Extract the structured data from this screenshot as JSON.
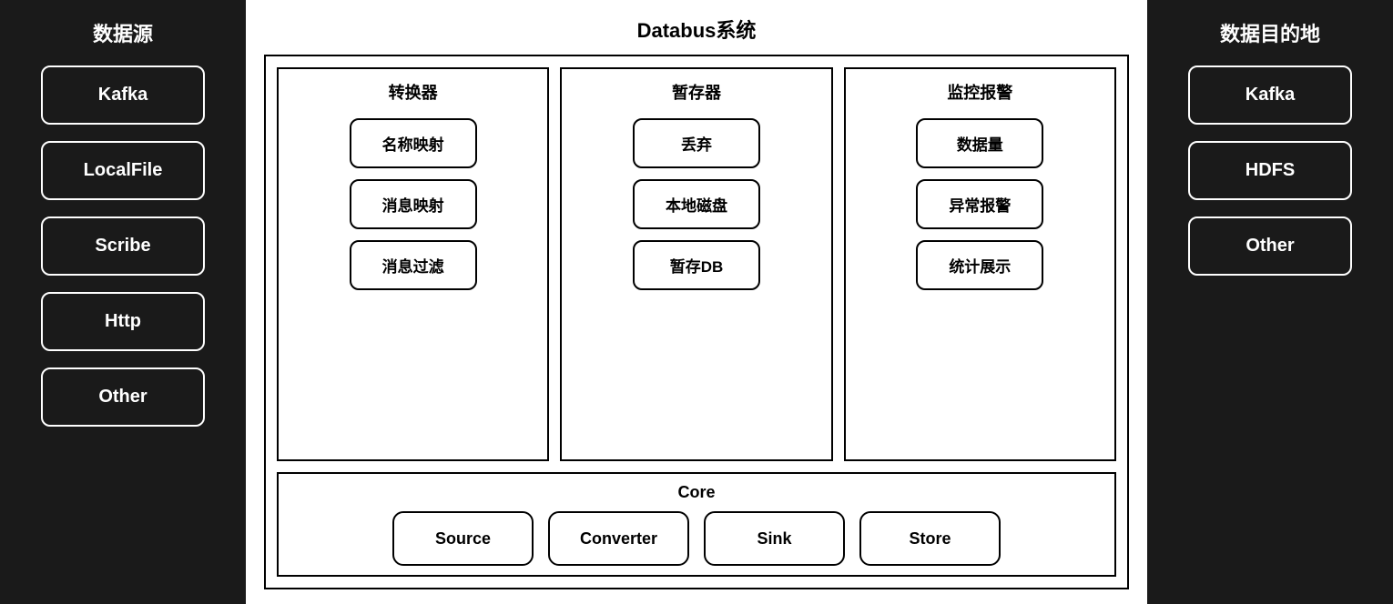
{
  "left": {
    "title": "数据源",
    "items": [
      "Kafka",
      "LocalFile",
      "Scribe",
      "Http",
      "Other"
    ]
  },
  "right": {
    "title": "数据目的地",
    "items": [
      "Kafka",
      "HDFS",
      "Other"
    ]
  },
  "center": {
    "main_title": "Databus系统",
    "top_boxes": [
      {
        "title": "转换器",
        "items": [
          "名称映射",
          "消息映射",
          "消息过滤"
        ]
      },
      {
        "title": "暂存器",
        "items": [
          "丢弃",
          "本地磁盘",
          "暂存DB"
        ]
      },
      {
        "title": "监控报警",
        "items": [
          "数据量",
          "异常报警",
          "统计展示"
        ]
      }
    ],
    "bottom": {
      "title": "Core",
      "items": [
        "Source",
        "Converter",
        "Sink",
        "Store"
      ]
    }
  }
}
